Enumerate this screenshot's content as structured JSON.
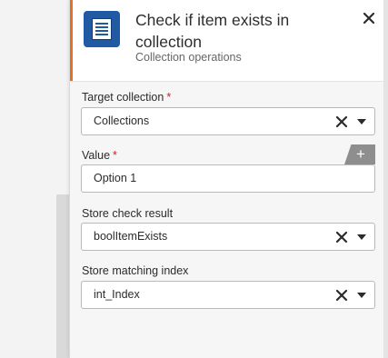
{
  "header": {
    "title": "Check if item exists in collection",
    "subtitle": "Collection operations",
    "icon": "document-list-icon",
    "accent_color": "#e37222",
    "icon_color": "#1f5aa3"
  },
  "close_icon": "close-icon",
  "fields": {
    "target_collection": {
      "label": "Target collection",
      "required_mark": "*",
      "value": "Collections"
    },
    "value": {
      "label": "Value",
      "required_mark": "*",
      "value": "Option 1",
      "add_label": "+"
    },
    "store_check_result": {
      "label": "Store check result",
      "value": "boolItemExists"
    },
    "store_matching_index": {
      "label": "Store matching index",
      "value": "int_Index"
    }
  }
}
